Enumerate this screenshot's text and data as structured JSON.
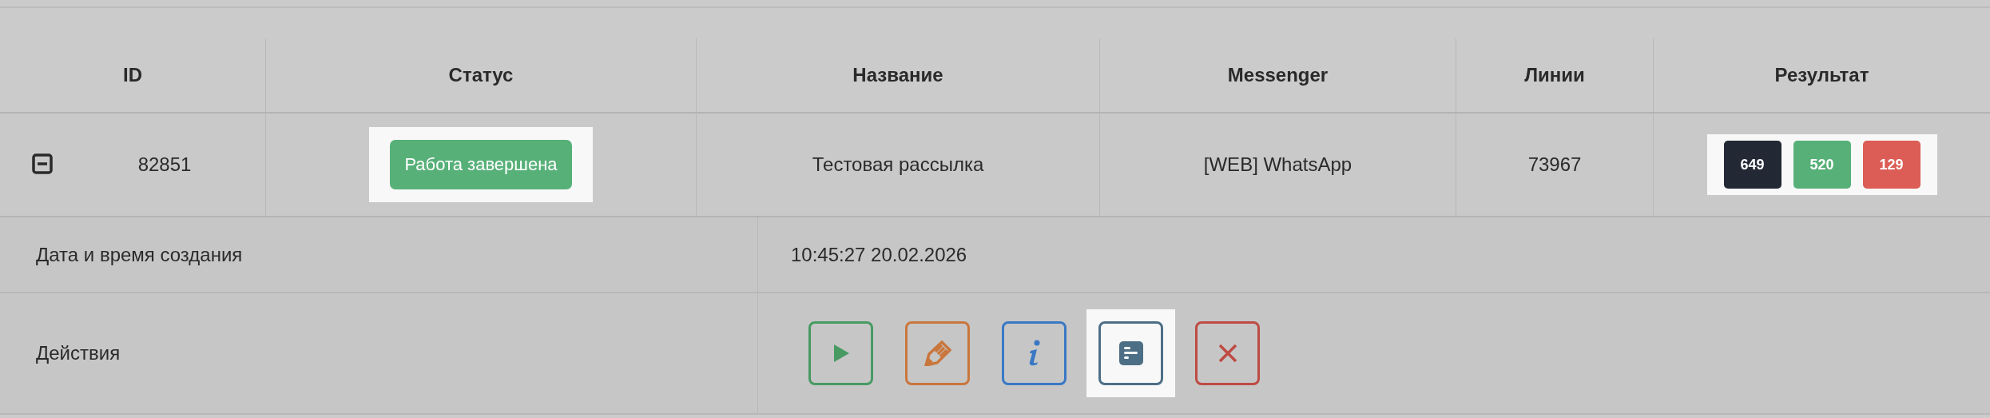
{
  "table": {
    "columns": [
      "ID",
      "Статус",
      "Название",
      "Messenger",
      "Линии",
      "Результат"
    ],
    "row": {
      "expanded": true,
      "id": "82851",
      "status": {
        "label": "Работа завершена",
        "highlighted": true
      },
      "name": "Тестовая рассылка",
      "messenger": "[WEB] WhatsApp",
      "lines": "73967",
      "results": {
        "highlighted": true,
        "items": [
          {
            "value": "649",
            "color": "#232835"
          },
          {
            "value": "520",
            "color": "#57b078"
          },
          {
            "value": "129",
            "color": "#dc5d56"
          }
        ]
      }
    },
    "details": [
      {
        "label": "Дата и время создания",
        "kind": "text",
        "value": "10:45:27 20.02.2026"
      },
      {
        "label": "Действия",
        "kind": "actions",
        "actions": [
          {
            "kind": "play",
            "highlighted": false
          },
          {
            "kind": "edit",
            "highlighted": false
          },
          {
            "kind": "info",
            "highlighted": false
          },
          {
            "kind": "report",
            "highlighted": true
          },
          {
            "kind": "delete",
            "highlighted": false
          }
        ]
      }
    ]
  }
}
